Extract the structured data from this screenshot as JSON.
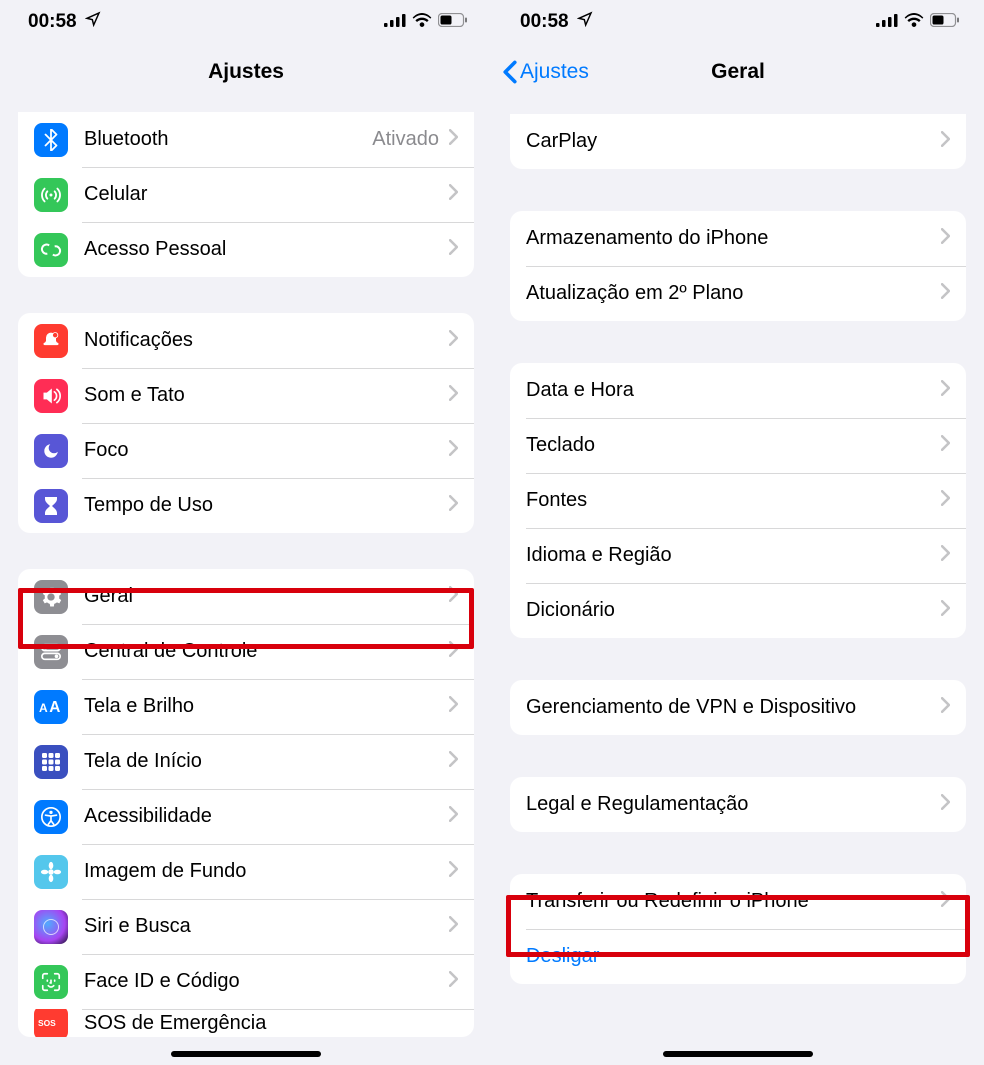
{
  "status": {
    "time": "00:58",
    "location_icon": "location-arrow",
    "signal": "cellular-signal",
    "wifi": "wifi",
    "battery": "battery-half"
  },
  "left": {
    "title": "Ajustes",
    "group1": [
      {
        "key": "bluetooth",
        "label": "Bluetooth",
        "value": "Ativado",
        "iconColor": "#007aff",
        "icon": "bluetooth"
      },
      {
        "key": "cellular",
        "label": "Celular",
        "value": "",
        "iconColor": "#34c759",
        "icon": "antenna"
      },
      {
        "key": "hotspot",
        "label": "Acesso Pessoal",
        "value": "",
        "iconColor": "#34c759",
        "icon": "link"
      }
    ],
    "group2": [
      {
        "key": "notifications",
        "label": "Notificações",
        "iconColor": "#ff3b30",
        "icon": "bell"
      },
      {
        "key": "sounds",
        "label": "Som e Tato",
        "iconColor": "#ff2d55",
        "icon": "speaker"
      },
      {
        "key": "focus",
        "label": "Foco",
        "iconColor": "#5856d6",
        "icon": "moon"
      },
      {
        "key": "screentime",
        "label": "Tempo de Uso",
        "iconColor": "#5856d6",
        "icon": "hourglass"
      }
    ],
    "group3": [
      {
        "key": "general",
        "label": "Geral",
        "iconColor": "#8e8e93",
        "icon": "gear",
        "highlight": true
      },
      {
        "key": "controlcenter",
        "label": "Central de Controle",
        "iconColor": "#8e8e93",
        "icon": "switches"
      },
      {
        "key": "display",
        "label": "Tela e Brilho",
        "iconColor": "#007aff",
        "icon": "textsize"
      },
      {
        "key": "homescreen",
        "label": "Tela de Início",
        "iconColor": "#3355cc",
        "icon": "grid"
      },
      {
        "key": "accessibility",
        "label": "Acessibilidade",
        "iconColor": "#007aff",
        "icon": "accessibility"
      },
      {
        "key": "wallpaper",
        "label": "Imagem de Fundo",
        "iconColor": "#54c7ec",
        "icon": "flower"
      },
      {
        "key": "siri",
        "label": "Siri e Busca",
        "iconColor": "#1b1b2f",
        "icon": "siri"
      },
      {
        "key": "faceid",
        "label": "Face ID e Código",
        "iconColor": "#34c759",
        "icon": "faceid"
      },
      {
        "key": "sos",
        "label": "SOS de Emergência",
        "iconColor": "#ff3b30",
        "icon": "sos"
      }
    ]
  },
  "right": {
    "back": "Ajustes",
    "title": "Geral",
    "group1": [
      {
        "key": "carplay",
        "label": "CarPlay"
      }
    ],
    "group2": [
      {
        "key": "storage",
        "label": "Armazenamento do iPhone"
      },
      {
        "key": "bgrefresh",
        "label": "Atualização em 2º Plano"
      }
    ],
    "group3": [
      {
        "key": "datetime",
        "label": "Data e Hora"
      },
      {
        "key": "keyboard",
        "label": "Teclado"
      },
      {
        "key": "fonts",
        "label": "Fontes"
      },
      {
        "key": "language",
        "label": "Idioma e Região"
      },
      {
        "key": "dictionary",
        "label": "Dicionário"
      }
    ],
    "group4": [
      {
        "key": "vpn",
        "label": "Gerenciamento de VPN e Dispositivo"
      }
    ],
    "group5": [
      {
        "key": "legal",
        "label": "Legal e Regulamentação"
      }
    ],
    "group6": [
      {
        "key": "transfer",
        "label": "Transferir ou Redefinir o iPhone",
        "highlight": true
      },
      {
        "key": "shutdown",
        "label": "Desligar",
        "link": true,
        "noChevron": true
      }
    ]
  }
}
